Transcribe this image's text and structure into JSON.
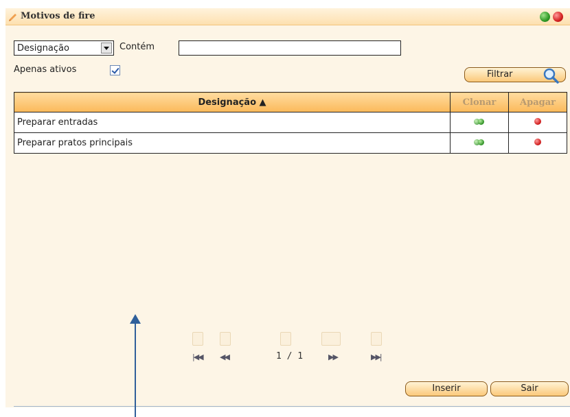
{
  "window": {
    "title": "Motivos de fire"
  },
  "filter": {
    "field_select": "Designação",
    "contains_label": "Contém",
    "contains_value": "",
    "active_only_label": "Apenas ativos",
    "active_only_checked": true,
    "filter_button": "Filtrar"
  },
  "grid": {
    "columns": {
      "designacao": "Designação ▲",
      "clonar": "Clonar",
      "apagar": "Apagar"
    },
    "rows": [
      {
        "designacao": "Preparar entradas"
      },
      {
        "designacao": "Preparar pratos principais"
      }
    ]
  },
  "pager": {
    "page_display": "1 / 1"
  },
  "actions": {
    "inserir": "Inserir",
    "sair": "Sair"
  },
  "colors": {
    "accent": "#fbb95a",
    "background": "#fdf5e6",
    "annotation_arrow": "#2f5f9a"
  }
}
